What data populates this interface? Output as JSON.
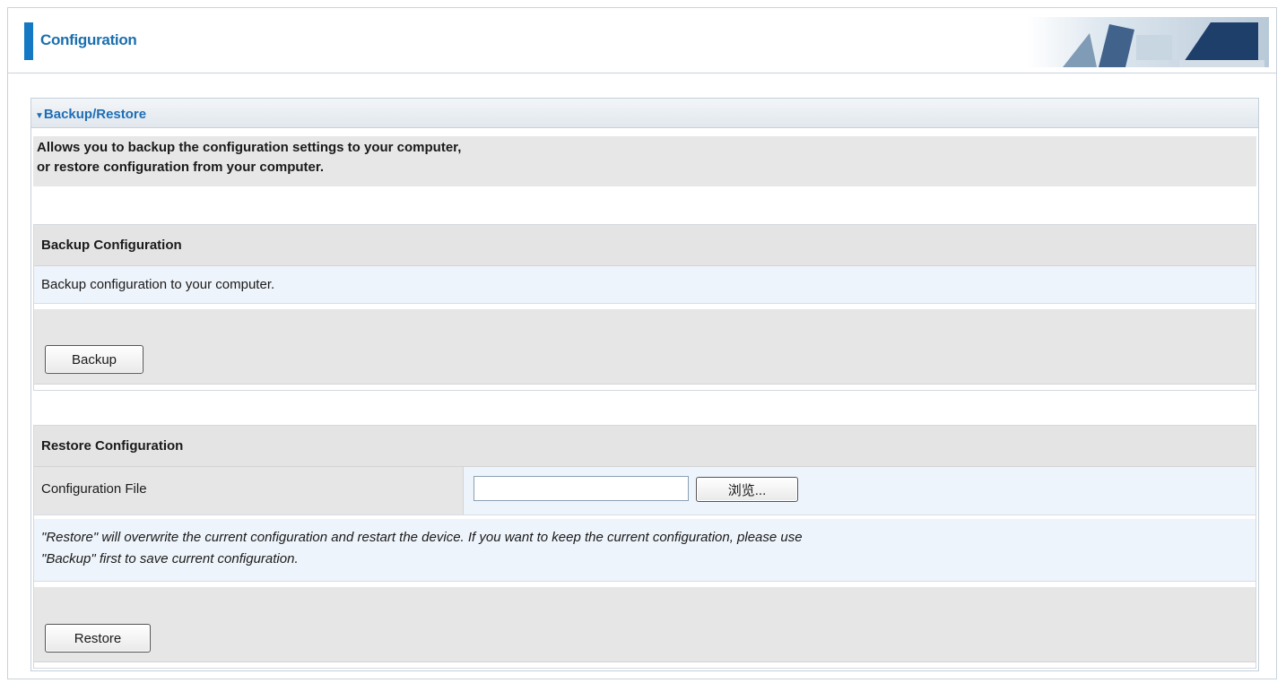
{
  "header": {
    "title": "Configuration"
  },
  "panel": {
    "title": "Backup/Restore",
    "description": [
      "Allows you to backup the configuration settings to your computer,",
      "or restore configuration from your computer."
    ]
  },
  "backup": {
    "section_title": "Backup Configuration",
    "info": "Backup configuration to your computer.",
    "button_label": "Backup"
  },
  "restore": {
    "section_title": "Restore Configuration",
    "file_label": "Configuration File",
    "file_value": "",
    "browse_label": "浏览...",
    "note": [
      "\"Restore\" will overwrite the current configuration and restart the device. If you want to keep the current configuration, please use",
      "\"Backup\" first to save current configuration."
    ],
    "button_label": "Restore"
  },
  "colors": {
    "accent": "#1479c2",
    "title_text": "#1a6fae",
    "section_bg": "#e4e4e4",
    "light_row_bg": "#eef4fb"
  }
}
